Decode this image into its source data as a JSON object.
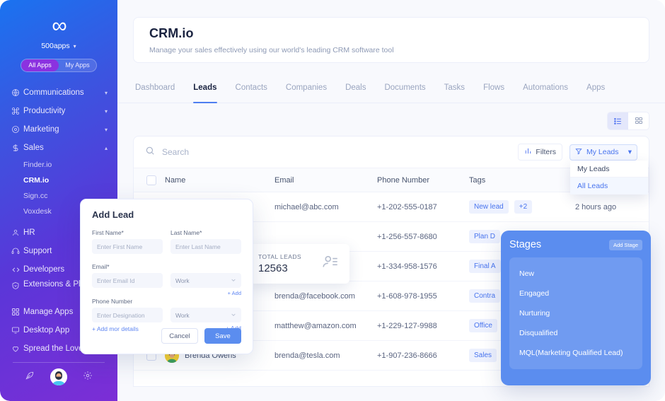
{
  "sidebar": {
    "logo_glyph": "∞",
    "brand": "500apps",
    "toggle": [
      {
        "label": "All Apps",
        "active": true
      },
      {
        "label": "My Apps",
        "active": false
      }
    ],
    "nav": [
      {
        "label": "Communications",
        "icon": "globe-icon",
        "chevron": "▾",
        "expandable": true
      },
      {
        "label": "Productivity",
        "icon": "command-icon",
        "chevron": "▾",
        "expandable": true
      },
      {
        "label": "Marketing",
        "icon": "target-icon",
        "chevron": "▾",
        "expandable": true
      },
      {
        "label": "Sales",
        "icon": "dollar-icon",
        "chevron": "▴",
        "expandable": true
      }
    ],
    "sales_children": [
      {
        "label": "Finder.io",
        "active": false
      },
      {
        "label": "CRM.io",
        "active": true
      },
      {
        "label": "Sign.cc",
        "active": false
      },
      {
        "label": "Voxdesk",
        "active": false
      }
    ],
    "nav2": [
      {
        "label": "HR",
        "icon": "user-icon"
      },
      {
        "label": "Support",
        "icon": "headset-icon"
      },
      {
        "label": "Developers",
        "icon": "code-icon"
      },
      {
        "label": "Extensions & Plugins",
        "icon": "shield-icon",
        "two_line": true
      },
      {
        "label": "Manage Apps",
        "icon": "grid-icon"
      },
      {
        "label": "Desktop App",
        "icon": "monitor-icon"
      },
      {
        "label": "Spread the Love",
        "icon": "heart-icon"
      }
    ],
    "footer_icons": [
      "feather-icon",
      "avatar",
      "gear-icon"
    ]
  },
  "header": {
    "title": "CRM.io",
    "subtitle": "Manage your sales effectively using our world's leading CRM software tool"
  },
  "tabs": [
    {
      "label": "Dashboard",
      "active": false
    },
    {
      "label": "Leads",
      "active": true
    },
    {
      "label": "Contacts",
      "active": false
    },
    {
      "label": "Companies",
      "active": false
    },
    {
      "label": "Deals",
      "active": false
    },
    {
      "label": "Documents",
      "active": false
    },
    {
      "label": "Tasks",
      "active": false
    },
    {
      "label": "Flows",
      "active": false
    },
    {
      "label": "Automations",
      "active": false
    },
    {
      "label": "Apps",
      "active": false
    }
  ],
  "view_toggle": {
    "list_icon": "list-view-icon",
    "grid_icon": "grid-view-icon",
    "active": "list"
  },
  "toolbar": {
    "search_placeholder": "Search",
    "search_value": "",
    "search_icon": "search-icon",
    "filters_label": "Filters",
    "filters_icon": "filter-sliders-icon",
    "leads_select_label": "My Leads",
    "leads_select_icon": "funnel-icon",
    "leads_select_chevron": "▾",
    "leads_options": [
      "My Leads",
      "All Leads"
    ]
  },
  "table": {
    "columns": [
      "Name",
      "Email",
      "Phone Number",
      "Tags",
      ""
    ],
    "rows": [
      {
        "name": "",
        "email": "michael@abc.com",
        "phone": "+1-202-555-0187",
        "tags": [
          "New lead",
          "+2"
        ],
        "time": "2 hours ago"
      },
      {
        "name": "",
        "email": "",
        "phone": "+1-256-557-8680",
        "tags": [
          "Plan D"
        ],
        "time": ""
      },
      {
        "name": "",
        "email": "",
        "phone": "+1-334-958-1576",
        "tags": [
          "Final A"
        ],
        "time": ""
      },
      {
        "name": "",
        "email": "brenda@facebook.com",
        "phone": "+1-608-978-1955",
        "tags": [
          "Contra"
        ],
        "time": ""
      },
      {
        "name": "",
        "email": "matthew@amazon.com",
        "phone": "+1-229-127-9988",
        "tags": [
          "Office"
        ],
        "time": ""
      },
      {
        "name": "Brenda Owens",
        "email": "brenda@tesla.com",
        "phone": "+1-907-236-8666",
        "tags": [
          "Sales"
        ],
        "time": ""
      }
    ]
  },
  "total_card": {
    "label": "TOTAL LEADS",
    "value": "12563",
    "icon": "contacts-icon"
  },
  "add_lead": {
    "title": "Add Lead",
    "first_name_label": "First Name*",
    "first_name_placeholder": "Enter First Name",
    "last_name_label": "Last Name*",
    "last_name_placeholder": "Enter Last Name",
    "email_label": "Email*",
    "email_placeholder": "Enter Email Id",
    "email_type": "Work",
    "email_add": "+ Add",
    "phone_label": "Phone Number",
    "phone_placeholder": "Enter Designation",
    "phone_type": "Work",
    "phone_add": "+ Add",
    "more_details": "+ Add mor details",
    "cancel_label": "Cancel",
    "save_label": "Save"
  },
  "stages": {
    "title": "Stages",
    "add_label": "Add Stage",
    "items": [
      "New",
      "Engaged",
      "Nurturing",
      "Disqualified",
      "MQL(Marketing Qualified Lead)"
    ]
  },
  "colors": {
    "accent_blue": "#5b8def",
    "link_blue": "#4874ee",
    "sidebar_start": "#1a73f0",
    "sidebar_end": "#7c2ed6",
    "tag_bg": "#edf1fe",
    "avatar_yellow": "#f6d02f"
  }
}
